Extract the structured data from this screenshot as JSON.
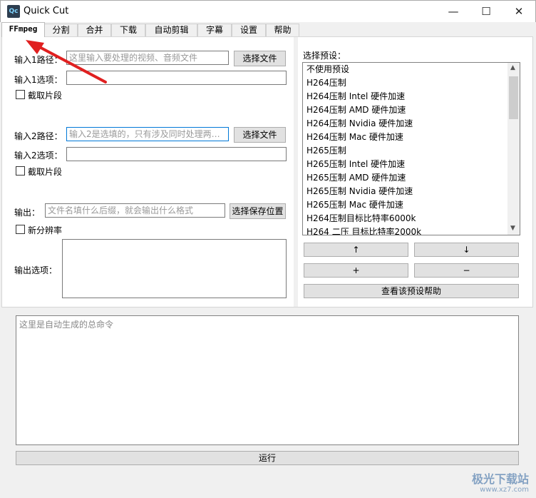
{
  "window": {
    "title": "Quick Cut",
    "logo_text": "Qc",
    "minimize": "—",
    "maximize": "☐",
    "close": "✕"
  },
  "tabs": [
    {
      "label": "FFmpeg",
      "active": true
    },
    {
      "label": "分割"
    },
    {
      "label": "合并"
    },
    {
      "label": "下载"
    },
    {
      "label": "自动剪辑"
    },
    {
      "label": "字幕"
    },
    {
      "label": "设置"
    },
    {
      "label": "帮助"
    }
  ],
  "ffmpeg": {
    "input1_path_label": "输入1路径：",
    "input1_path_placeholder": "这里输入要处理的视频、音频文件",
    "input1_choose": "选择文件",
    "input1_options_label": "输入1选项：",
    "input1_clip": "截取片段",
    "input2_path_label": "输入2路径：",
    "input2_path_placeholder": "输入2是选填的，只有涉及同时处理两…",
    "input2_choose": "选择文件",
    "input2_options_label": "输入2选项：",
    "input2_clip": "截取片段",
    "output_label": "输出：",
    "output_placeholder": "文件名填什么后缀，就会输出什么格式",
    "output_choose": "选择保存位置",
    "new_resolution": "新分辨率",
    "output_options_label": "输出选项：",
    "preset_label": "选择预设：",
    "presets": [
      "不使用预设",
      "H264压制",
      "H264压制 Intel 硬件加速",
      "H264压制 AMD 硬件加速",
      "H264压制 Nvidia 硬件加速",
      "H264压制 Mac 硬件加速",
      "H265压制",
      "H265压制 Intel 硬件加速",
      "H265压制 AMD 硬件加速",
      "H265压制 Nvidia 硬件加速",
      "H265压制 Mac 硬件加速",
      "H264压制目标比特率6000k",
      "H264 二压 目标比特率2000k"
    ],
    "move_up": "↑",
    "move_down": "↓",
    "add": "+",
    "remove": "−",
    "preset_help": "查看该预设帮助",
    "command_placeholder": "这里是自动生成的总命令",
    "run": "运行"
  },
  "annotation_color": "#e02020",
  "watermark": {
    "name": "极光下载站",
    "url": "www.xz7.com"
  }
}
